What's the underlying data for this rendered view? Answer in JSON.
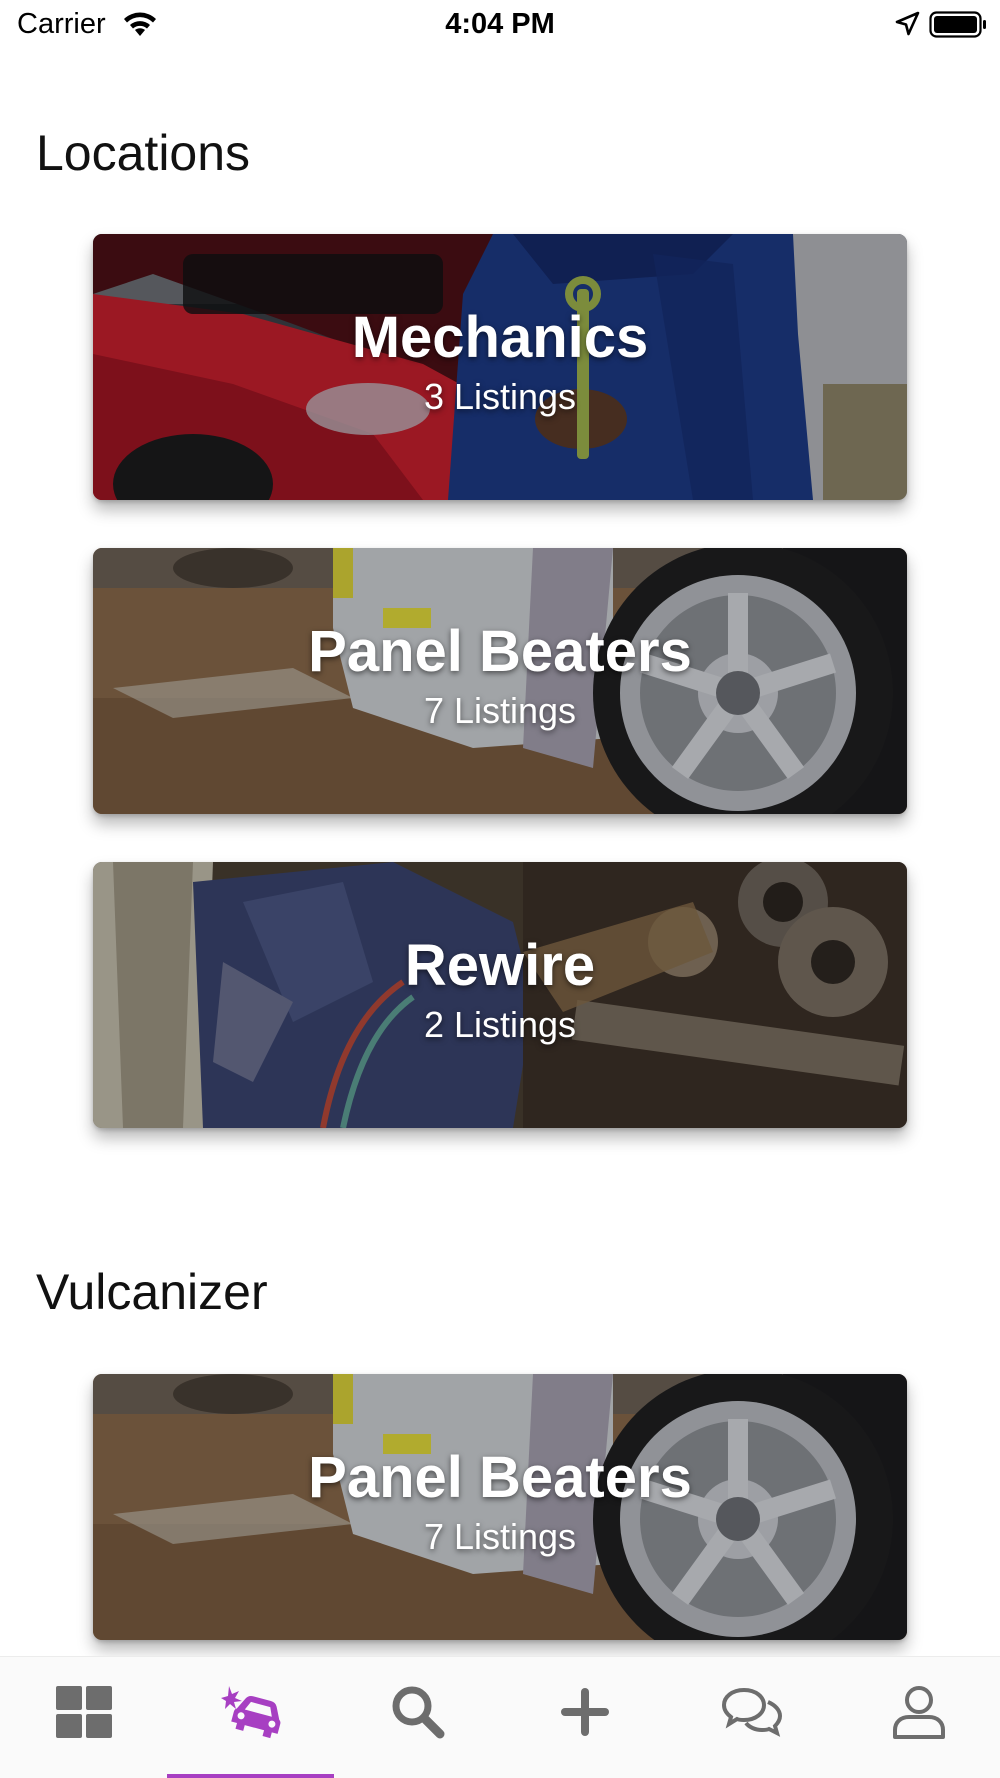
{
  "status_bar": {
    "carrier": "Carrier",
    "time": "4:04 PM"
  },
  "sections": [
    {
      "title": "Locations",
      "cards": [
        {
          "title": "Mechanics",
          "count": "3 Listings",
          "image": "mechanic-with-wrench-photo"
        },
        {
          "title": "Panel Beaters",
          "count": "7 Listings",
          "image": "car-wheel-photo"
        },
        {
          "title": "Rewire",
          "count": "2 Listings",
          "image": "engine-welding-photo"
        }
      ]
    },
    {
      "title": "Vulcanizer",
      "cards": [
        {
          "title": "Panel Beaters",
          "count": "7 Listings",
          "image": "car-wheel-photo"
        }
      ]
    }
  ],
  "tab_bar": {
    "tabs": [
      {
        "icon": "grid-icon",
        "active": false
      },
      {
        "icon": "car-crash-icon",
        "active": true
      },
      {
        "icon": "search-icon",
        "active": false
      },
      {
        "icon": "plus-icon",
        "active": false
      },
      {
        "icon": "chat-bubbles-icon",
        "active": false
      },
      {
        "icon": "user-icon",
        "active": false
      }
    ],
    "active_color": "#a73fc2",
    "inactive_color": "#6d6d6d"
  }
}
